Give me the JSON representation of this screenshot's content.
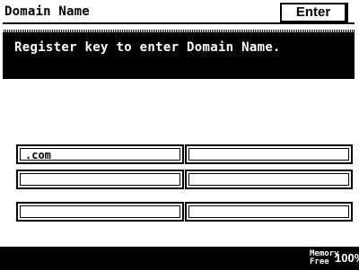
{
  "header": {
    "title": "Domain Name",
    "enter_label": "Enter"
  },
  "message": "Register key to enter Domain Name.",
  "keys": [
    ".com",
    "",
    "",
    "",
    "",
    ""
  ],
  "status": {
    "memory_label": "Memory",
    "free_label": "Free",
    "memory_value": "100%"
  }
}
